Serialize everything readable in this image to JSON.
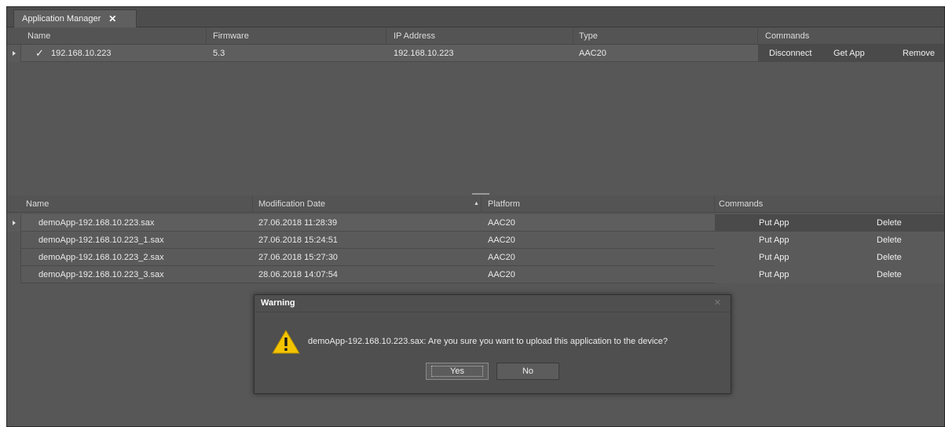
{
  "tab": {
    "title": "Application Manager",
    "close": "✕"
  },
  "devices": {
    "columns": [
      "Name",
      "Firmware",
      "IP Address",
      "Type",
      "Commands"
    ],
    "rows": [
      {
        "checked": "✓",
        "name": "192.168.10.223",
        "firmware": "5.3",
        "ip": "192.168.10.223",
        "type": "AAC20",
        "commands": [
          "Disconnect",
          "Get App",
          "Remove"
        ]
      }
    ]
  },
  "apps": {
    "columns": [
      "Name",
      "Modification Date",
      "Platform",
      "Commands"
    ],
    "sort_indicator": "▲",
    "rows": [
      {
        "name": "demoApp-192.168.10.223.sax",
        "date": "27.06.2018 11:28:39",
        "platform": "AAC20",
        "put": "Put App",
        "delete": "Delete"
      },
      {
        "name": "demoApp-192.168.10.223_1.sax",
        "date": "27.06.2018 15:24:51",
        "platform": "AAC20",
        "put": "Put App",
        "delete": "Delete"
      },
      {
        "name": "demoApp-192.168.10.223_2.sax",
        "date": "27.06.2018 15:27:30",
        "platform": "AAC20",
        "put": "Put App",
        "delete": "Delete"
      },
      {
        "name": "demoApp-192.168.10.223_3.sax",
        "date": "28.06.2018 14:07:54",
        "platform": "AAC20",
        "put": "Put App",
        "delete": "Delete"
      }
    ]
  },
  "dialog": {
    "title": "Warning",
    "close": "✕",
    "message": "demoApp-192.168.10.223.sax: Are you sure you want to upload this application to the device?",
    "yes": "Yes",
    "no": "No",
    "icon": "warning-icon"
  },
  "colors": {
    "background": "#575757",
    "dialog": "#4f4f4f",
    "warning_yellow": "#f5c400"
  }
}
